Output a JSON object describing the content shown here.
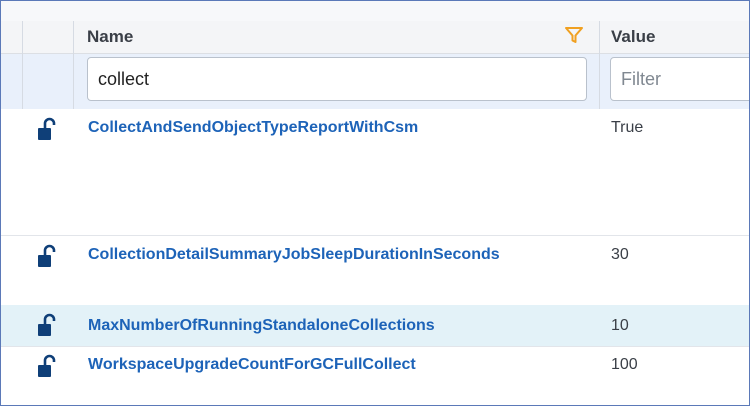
{
  "columns": {
    "name_label": "Name",
    "value_label": "Value"
  },
  "filters": {
    "name_value": "collect",
    "value_placeholder": "Filter"
  },
  "rows": [
    {
      "name": "CollectAndSendObjectTypeReportWithCsm",
      "value": "True",
      "locked": false,
      "highlighted": false
    },
    {
      "name": "CollectionDetailSummaryJobSleepDurationInSeconds",
      "value": "30",
      "locked": false,
      "highlighted": false
    },
    {
      "name": "MaxNumberOfRunningStandaloneCollections",
      "value": "10",
      "locked": false,
      "highlighted": true
    },
    {
      "name": "WorkspaceUpgradeCountForGCFullCollect",
      "value": "100",
      "locked": false,
      "highlighted": false
    }
  ],
  "colors": {
    "link": "#1d63b8",
    "filter_icon": "#f0a020",
    "lock_icon": "#0f3f78",
    "highlight_row": "#e3f2f8"
  },
  "icons": {
    "filter": "funnel-icon",
    "lock": "unlocked-padlock-icon"
  }
}
